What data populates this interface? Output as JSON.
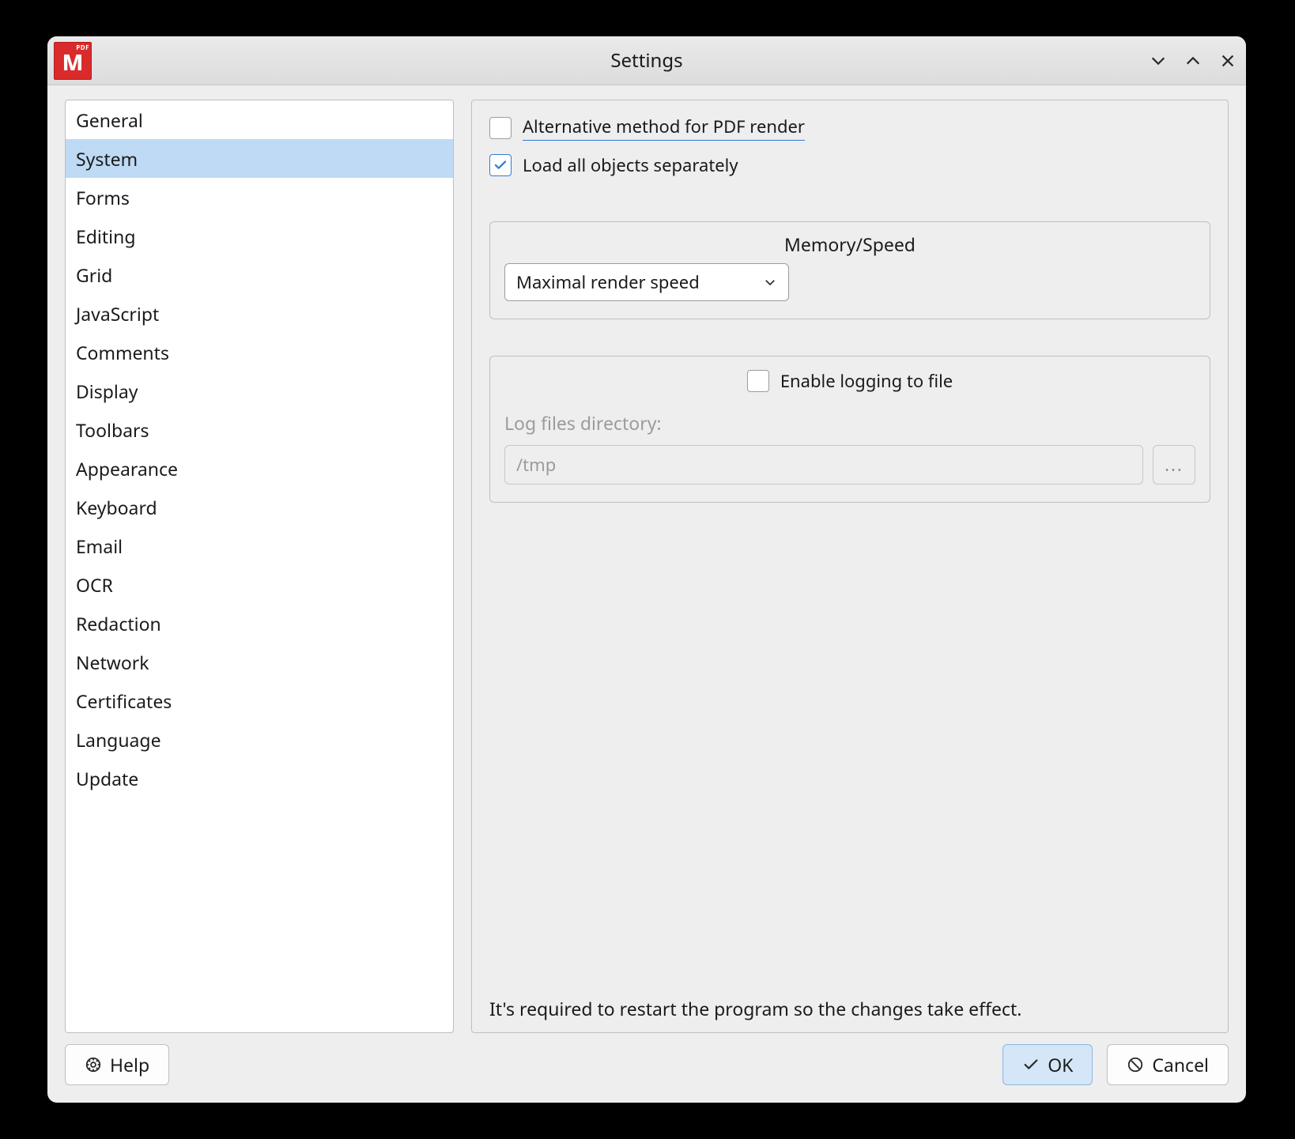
{
  "window": {
    "title": "Settings",
    "appicon_badge": "PDF"
  },
  "sidebar": {
    "items": [
      "General",
      "System",
      "Forms",
      "Editing",
      "Grid",
      "JavaScript",
      "Comments",
      "Display",
      "Toolbars",
      "Appearance",
      "Keyboard",
      "Email",
      "OCR",
      "Redaction",
      "Network",
      "Certificates",
      "Language",
      "Update"
    ],
    "selected": "System"
  },
  "pane": {
    "alt_render_label": "Alternative method for PDF render",
    "alt_render_checked": false,
    "load_separately_label": "Load all objects separately",
    "load_separately_checked": true,
    "memory_speed": {
      "title": "Memory/Speed",
      "value": "Maximal render speed"
    },
    "logging": {
      "enable_label": "Enable logging to file",
      "enable_checked": false,
      "dir_label": "Log files directory:",
      "dir_value": "/tmp",
      "browse_label": "..."
    },
    "restart_note": "It's required to restart the program so the changes take effect."
  },
  "footer": {
    "help": "Help",
    "ok": "OK",
    "cancel": "Cancel"
  }
}
